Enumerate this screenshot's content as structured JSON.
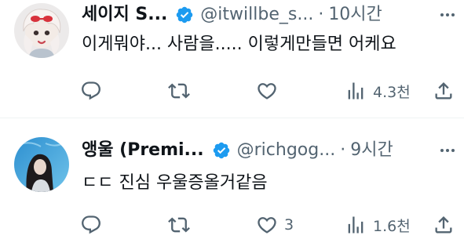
{
  "tweets": [
    {
      "display_name": "세이지 S...",
      "handle": "@itwillbe_s...",
      "separator": "·",
      "time": "10시간",
      "text": "이게뭐야... 사람을..... 이렇게만들면 어케요",
      "reply_count": "",
      "retweet_count": "",
      "like_count": "",
      "view_count": "4.3천"
    },
    {
      "display_name": "앵울 (Premi...",
      "handle": "@richgog...",
      "separator": "·",
      "time": "9시간",
      "text": "ㄷㄷ 진심 우울증올거같음",
      "reply_count": "",
      "retweet_count": "",
      "like_count": "3",
      "view_count": "1.6천"
    }
  ],
  "colors": {
    "verified_badge": "#1d9bf0",
    "secondary_text": "#536471",
    "primary_text": "#0f1419",
    "divider": "#eff3f4"
  },
  "icons": [
    "verified-badge-icon",
    "reply-icon",
    "retweet-icon",
    "like-icon",
    "views-icon",
    "share-icon"
  ]
}
